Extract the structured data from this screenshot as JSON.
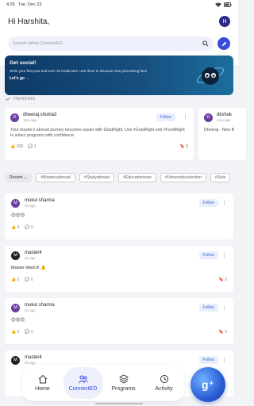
{
  "statusbar": {
    "time": "4:25",
    "date": "Tue, Dec 23"
  },
  "header": {
    "greeting": "Hi Harshita,",
    "avatar_initial": "H",
    "search_placeholder": "Search within ConnectED"
  },
  "banner": {
    "title": "Get social!",
    "text": "Write your first post and earn 10 Gradcoins. Use them to discount loan processing fees",
    "link": "Let's go →"
  },
  "trending": {
    "label": "TRENDING",
    "cards": [
      {
        "initial": "D",
        "name": "dheeraj.shukla3",
        "time": "1mo ago",
        "follow": "Follow",
        "text": "Your master's abroad journey becomes easier with GradRight. Use #GradRight and #FundRight to select programs with confidence.",
        "likes": "100",
        "comments": "1",
        "saves": "0"
      },
      {
        "initial": "D",
        "name": "dkshuk",
        "time": "1mo ago",
        "text": "Dheeraj - New B"
      }
    ]
  },
  "filters": {
    "recent": "Recent",
    "chips": [
      "#Mastersabroad",
      "#Studyabroad",
      "#Educationloan",
      "#Universityselection",
      "#Sele"
    ]
  },
  "posts": [
    {
      "initial": "M",
      "avatar": "purple",
      "name": "mukul sharma",
      "time": "4h ago",
      "follow": "Follow",
      "text": "😊😊😊",
      "likes": "0",
      "comments": "0"
    },
    {
      "initial": "M",
      "avatar": "dark",
      "name": "master4",
      "time": "4h ago",
      "follow": "Follow",
      "text": "Master kiled it! ⚠️",
      "likes": "0",
      "comments": "0",
      "saves": "0"
    },
    {
      "initial": "M",
      "avatar": "purple",
      "name": "mukul sharma",
      "time": "4h ago",
      "follow": "Follow",
      "text": "😊😊😊",
      "likes": "0",
      "comments": "0",
      "saves": "0"
    },
    {
      "initial": "M",
      "avatar": "dark",
      "name": "master4",
      "time": "4h ago",
      "follow": "Follow",
      "text": "",
      "likes": "",
      "comments": ""
    }
  ],
  "nav": {
    "items": [
      {
        "label": "Home",
        "icon": "home-icon"
      },
      {
        "label": "ConnectED",
        "icon": "people-icon"
      },
      {
        "label": "Programs",
        "icon": "layers-icon"
      },
      {
        "label": "Activity",
        "icon": "activity-icon"
      }
    ],
    "fab": "g⁺"
  },
  "colors": {
    "accent": "#3a4bd9",
    "banner": "#0e3a66",
    "follow_bg": "#e8eefc"
  }
}
